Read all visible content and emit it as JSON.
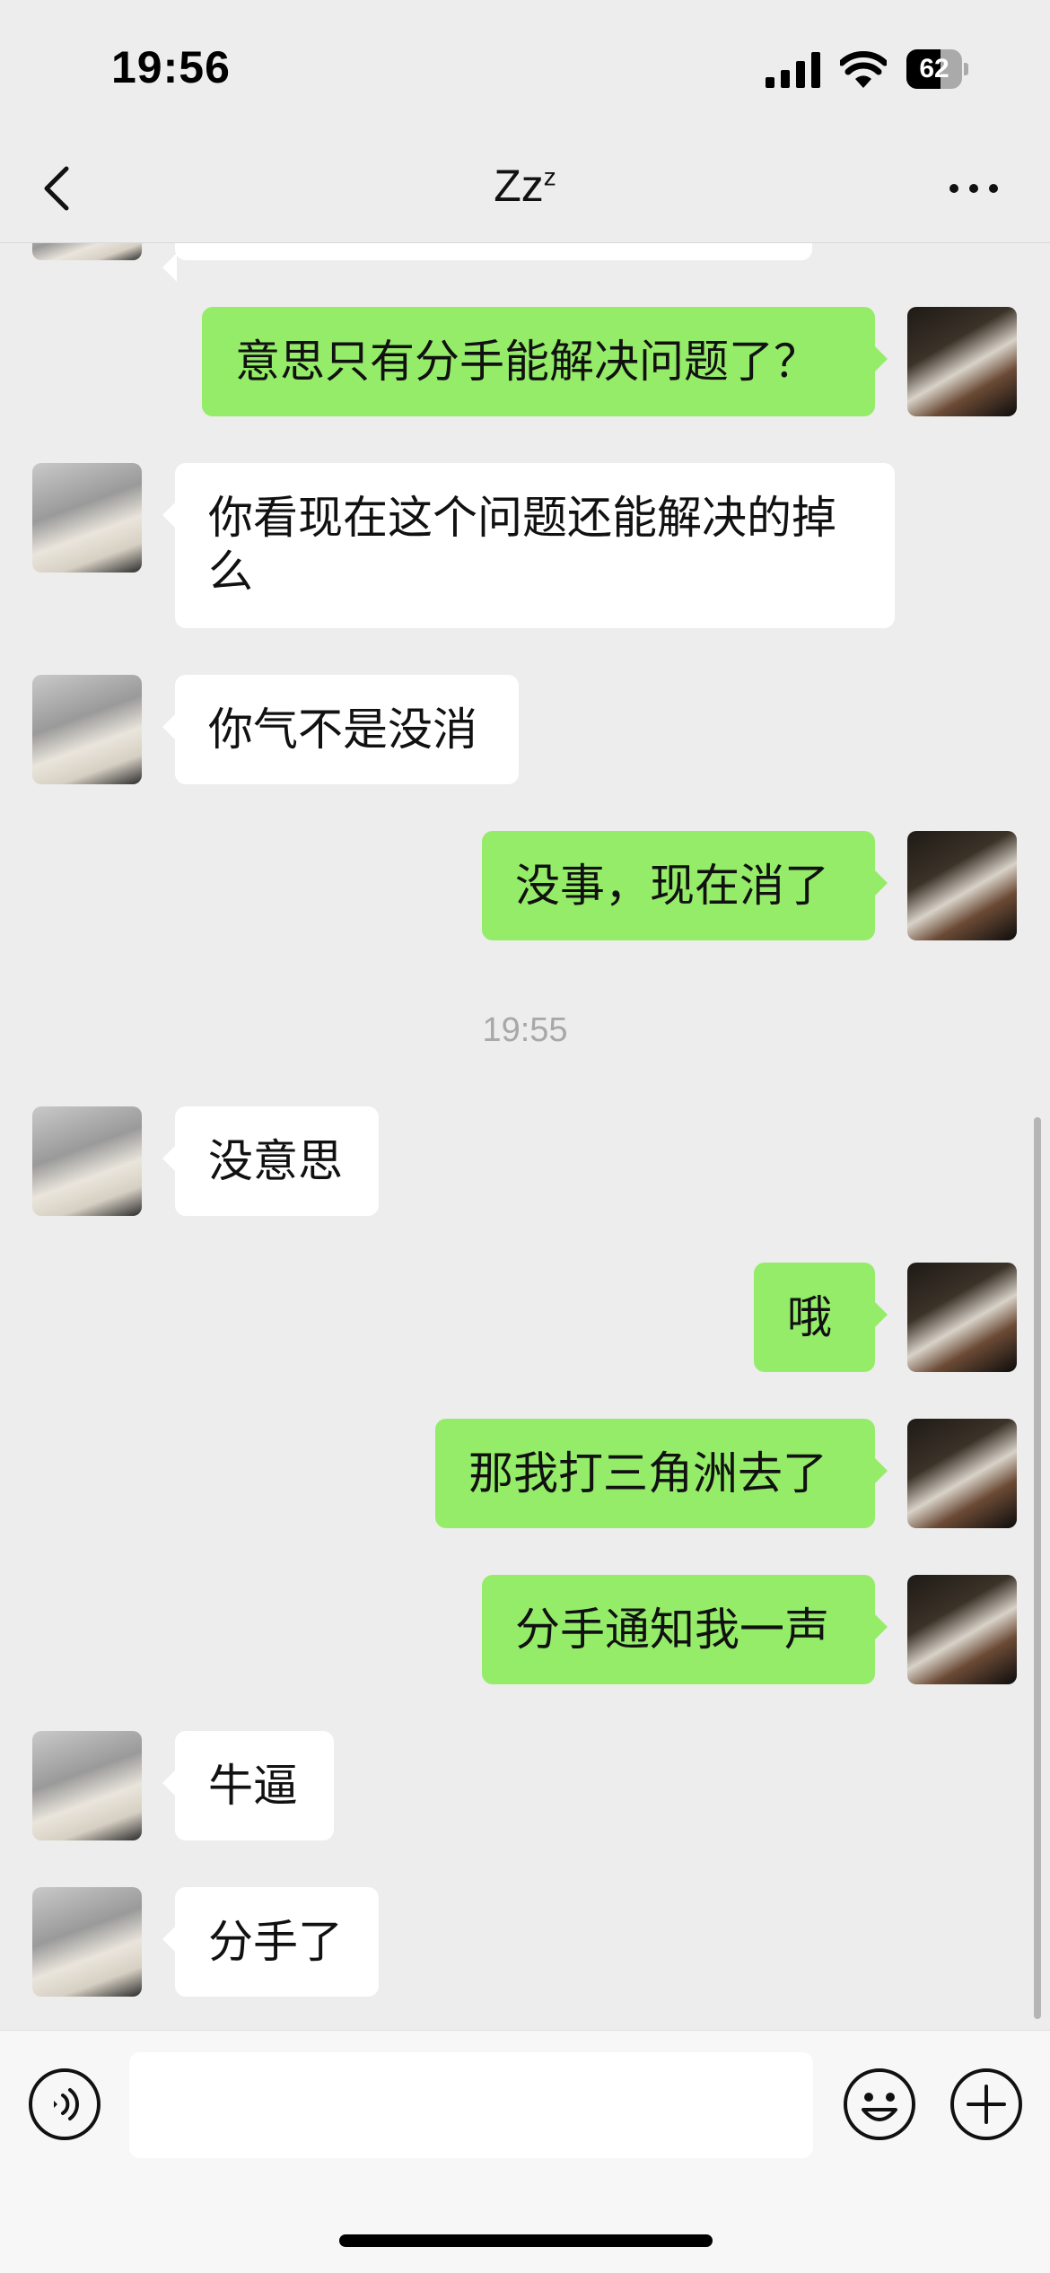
{
  "status_bar": {
    "time": "19:56",
    "battery_level": "62",
    "battery_fraction": 0.62
  },
  "header": {
    "title": "Zz",
    "title_sup": "z"
  },
  "messages": [
    {
      "side": "right",
      "text": "意思只有分手能解决问题了？"
    },
    {
      "side": "left",
      "text": "你看现在这个问题还能解决的掉么"
    },
    {
      "side": "left",
      "text": "你气不是没消"
    },
    {
      "side": "right",
      "text": "没事，现在消了"
    },
    {
      "type": "timestamp",
      "text": "19:55"
    },
    {
      "side": "left",
      "text": "没意思"
    },
    {
      "side": "right",
      "text": "哦"
    },
    {
      "side": "right",
      "text": "那我打三角洲去了"
    },
    {
      "side": "right",
      "text": "分手通知我一声"
    },
    {
      "side": "left",
      "text": "牛逼"
    },
    {
      "side": "left",
      "text": "分手了"
    }
  ],
  "input": {
    "value": "",
    "placeholder": ""
  },
  "colors": {
    "sent_bubble": "#95ec69",
    "received_bubble": "#ffffff",
    "background": "#ededed"
  },
  "icons": {
    "back": "chevron-left-icon",
    "more": "ellipsis-icon",
    "voice": "voice-icon",
    "emoji": "smiley-icon",
    "plus": "plus-icon"
  }
}
